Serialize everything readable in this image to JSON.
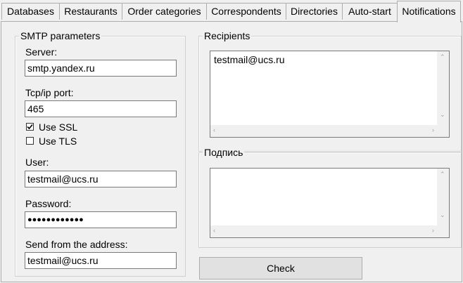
{
  "tabs": [
    {
      "label": "Databases"
    },
    {
      "label": "Restaurants"
    },
    {
      "label": "Order categories"
    },
    {
      "label": "Correspondents"
    },
    {
      "label": "Directories"
    },
    {
      "label": "Auto-start"
    },
    {
      "label": "Notifications"
    }
  ],
  "active_tab": "Notifications",
  "smtp": {
    "legend": "SMTP parameters",
    "server_label": "Server:",
    "server_value": "smtp.yandex.ru",
    "port_label": "Tcp/ip port:",
    "port_value": "465",
    "use_ssl_label": "Use SSL",
    "use_ssl_checked": true,
    "use_tls_label": "Use TLS",
    "use_tls_checked": false,
    "user_label": "User:",
    "user_value": "testmail@ucs.ru",
    "password_label": "Password:",
    "password_value": "●●●●●●●●●●●●",
    "from_label": "Send from the address:",
    "from_value": "testmail@ucs.ru"
  },
  "recipients": {
    "legend": "Recipients",
    "text": "testmail@ucs.ru"
  },
  "signature": {
    "legend": "Подпись",
    "text": ""
  },
  "check_button": {
    "label": "Check"
  },
  "icons": {
    "scroll_up": "scroll-up-arrow-icon",
    "scroll_down": "scroll-down-arrow-icon",
    "scroll_left": "scroll-left-arrow-icon",
    "scroll_right": "scroll-right-arrow-icon",
    "checkmark": "checkmark-icon"
  }
}
